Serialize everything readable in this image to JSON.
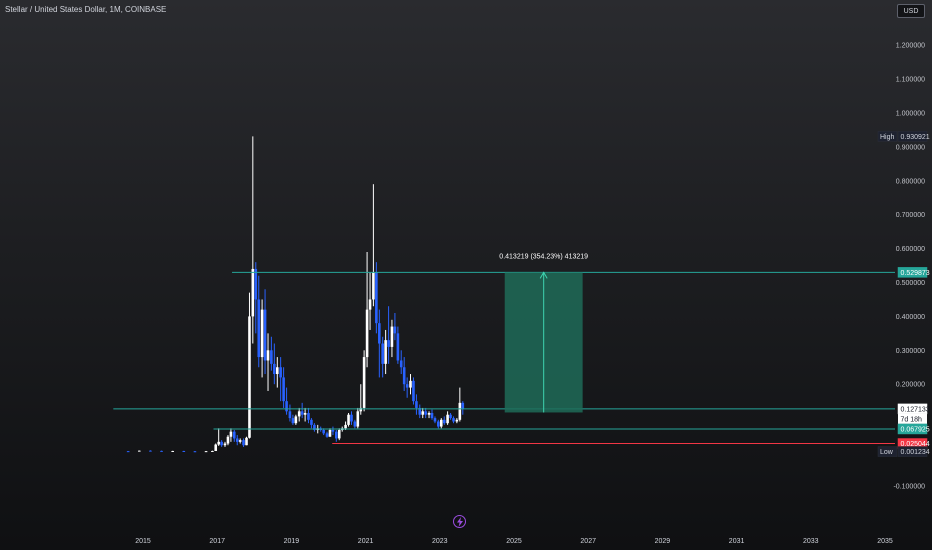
{
  "header": {
    "title": "Stellar / United States Dollar, 1M, COINBASE",
    "currency": "USD"
  },
  "icons": {
    "bolt": "lightning-bolt-icon"
  },
  "chart_data": {
    "type": "candlestick",
    "title": "Stellar / United States Dollar, 1M, COINBASE",
    "ylim": [
      -0.12,
      1.26
    ],
    "xlim": [
      2014.2,
      2035.5
    ],
    "y_ticks": [
      "1.200000",
      "1.100000",
      "1.000000",
      "0.900000",
      "0.800000",
      "0.700000",
      "0.600000",
      "0.500000",
      "0.400000",
      "0.300000",
      "0.200000",
      "-0.100000"
    ],
    "x_ticks": [
      "2015",
      "2017",
      "2019",
      "2021",
      "2023",
      "2025",
      "2027",
      "2029",
      "2031",
      "2033",
      "2035"
    ],
    "colors": {
      "up": "#ffffff",
      "down": "#2962ff",
      "teal": "#26a69a",
      "red": "#f23645",
      "measure": "#1f6b58"
    },
    "horizontal_lines": [
      {
        "value": 0.529873,
        "color": "#26a69a",
        "from": 2017.4,
        "to": 2035.5
      },
      {
        "value": 0.127133,
        "color": "#26a69a",
        "from": 2014.2,
        "to": 2035.5
      },
      {
        "value": 0.067925,
        "color": "#26a69a",
        "from": 2016.9,
        "to": 2035.5
      },
      {
        "value": 0.025044,
        "color": "#f23645",
        "from": 2020.1,
        "to": 2035.5
      }
    ],
    "price_tags": [
      {
        "label": "High",
        "value_text": "0.930921",
        "value": 0.930921,
        "style": "dark"
      },
      {
        "label": "",
        "value_text": "0.529873",
        "value": 0.529873,
        "style": "teal"
      },
      {
        "label": "",
        "value_text": "0.127133",
        "value": 0.127133,
        "style": "white",
        "sub": "7d 18h"
      },
      {
        "label": "",
        "value_text": "0.067925",
        "value": 0.067925,
        "style": "teal"
      },
      {
        "label": "",
        "value_text": "0.025044",
        "value": 0.025044,
        "style": "red"
      },
      {
        "label": "Low",
        "value_text": "0.001234",
        "value": 0.001234,
        "style": "dark"
      }
    ],
    "measure": {
      "label": "0.413219 (354.23%) 413219",
      "x_start": 2024.75,
      "x_end": 2026.85,
      "y_low": 0.116654,
      "y_high": 0.529873
    },
    "candles": [
      [
        2014.6,
        0.0025,
        0.003,
        0.002,
        0.0024
      ],
      [
        2014.9,
        0.0024,
        0.0045,
        0.0018,
        0.004
      ],
      [
        2015.2,
        0.004,
        0.005,
        0.003,
        0.0033
      ],
      [
        2015.5,
        0.0033,
        0.004,
        0.002,
        0.0025
      ],
      [
        2015.8,
        0.0025,
        0.0035,
        0.002,
        0.003
      ],
      [
        2016.1,
        0.003,
        0.0035,
        0.002,
        0.0022
      ],
      [
        2016.4,
        0.0022,
        0.003,
        0.0015,
        0.002
      ],
      [
        2016.7,
        0.002,
        0.003,
        0.0015,
        0.0025
      ],
      [
        2016.87,
        0.0025,
        0.004,
        0.002,
        0.003
      ],
      [
        2016.96,
        0.003,
        0.025,
        0.003,
        0.022
      ],
      [
        2017.04,
        0.022,
        0.07,
        0.018,
        0.03
      ],
      [
        2017.12,
        0.03,
        0.035,
        0.015,
        0.02
      ],
      [
        2017.21,
        0.02,
        0.03,
        0.015,
        0.025
      ],
      [
        2017.29,
        0.025,
        0.05,
        0.02,
        0.045
      ],
      [
        2017.37,
        0.045,
        0.07,
        0.03,
        0.06
      ],
      [
        2017.46,
        0.06,
        0.065,
        0.03,
        0.04
      ],
      [
        2017.54,
        0.04,
        0.05,
        0.02,
        0.03
      ],
      [
        2017.62,
        0.03,
        0.04,
        0.025,
        0.035
      ],
      [
        2017.71,
        0.035,
        0.04,
        0.015,
        0.02
      ],
      [
        2017.79,
        0.02,
        0.045,
        0.02,
        0.042
      ],
      [
        2017.87,
        0.042,
        0.47,
        0.04,
        0.4
      ],
      [
        2017.96,
        0.4,
        0.9309,
        0.32,
        0.54
      ],
      [
        2018.04,
        0.54,
        0.56,
        0.35,
        0.45
      ],
      [
        2018.12,
        0.45,
        0.52,
        0.25,
        0.28
      ],
      [
        2018.21,
        0.28,
        0.45,
        0.22,
        0.42
      ],
      [
        2018.29,
        0.42,
        0.48,
        0.23,
        0.27
      ],
      [
        2018.37,
        0.27,
        0.35,
        0.18,
        0.3
      ],
      [
        2018.46,
        0.3,
        0.34,
        0.24,
        0.26
      ],
      [
        2018.54,
        0.26,
        0.32,
        0.2,
        0.23
      ],
      [
        2018.62,
        0.23,
        0.28,
        0.19,
        0.25
      ],
      [
        2018.71,
        0.25,
        0.28,
        0.15,
        0.22
      ],
      [
        2018.79,
        0.22,
        0.25,
        0.13,
        0.15
      ],
      [
        2018.87,
        0.15,
        0.19,
        0.11,
        0.12
      ],
      [
        2018.96,
        0.12,
        0.14,
        0.09,
        0.1
      ],
      [
        2019.04,
        0.1,
        0.11,
        0.08,
        0.085
      ],
      [
        2019.12,
        0.085,
        0.11,
        0.08,
        0.105
      ],
      [
        2019.21,
        0.105,
        0.13,
        0.09,
        0.12
      ],
      [
        2019.29,
        0.12,
        0.145,
        0.1,
        0.11
      ],
      [
        2019.37,
        0.11,
        0.13,
        0.09,
        0.115
      ],
      [
        2019.46,
        0.115,
        0.13,
        0.085,
        0.095
      ],
      [
        2019.54,
        0.095,
        0.1,
        0.07,
        0.08
      ],
      [
        2019.62,
        0.08,
        0.085,
        0.06,
        0.065
      ],
      [
        2019.71,
        0.065,
        0.08,
        0.055,
        0.07
      ],
      [
        2019.79,
        0.07,
        0.075,
        0.06,
        0.065
      ],
      [
        2019.87,
        0.065,
        0.07,
        0.05,
        0.055
      ],
      [
        2019.96,
        0.055,
        0.06,
        0.042,
        0.045
      ],
      [
        2020.04,
        0.045,
        0.07,
        0.045,
        0.065
      ],
      [
        2020.12,
        0.065,
        0.075,
        0.05,
        0.06
      ],
      [
        2020.21,
        0.06,
        0.065,
        0.03,
        0.04
      ],
      [
        2020.29,
        0.04,
        0.07,
        0.035,
        0.065
      ],
      [
        2020.37,
        0.065,
        0.075,
        0.06,
        0.07
      ],
      [
        2020.46,
        0.07,
        0.09,
        0.065,
        0.08
      ],
      [
        2020.54,
        0.08,
        0.115,
        0.075,
        0.11
      ],
      [
        2020.62,
        0.11,
        0.12,
        0.08,
        0.09
      ],
      [
        2020.71,
        0.09,
        0.095,
        0.07,
        0.075
      ],
      [
        2020.79,
        0.075,
        0.13,
        0.07,
        0.12
      ],
      [
        2020.87,
        0.12,
        0.2,
        0.11,
        0.13
      ],
      [
        2020.96,
        0.13,
        0.3,
        0.12,
        0.28
      ],
      [
        2021.04,
        0.28,
        0.59,
        0.25,
        0.42
      ],
      [
        2021.12,
        0.42,
        0.53,
        0.36,
        0.45
      ],
      [
        2021.21,
        0.45,
        0.79,
        0.43,
        0.53
      ],
      [
        2021.29,
        0.53,
        0.56,
        0.35,
        0.38
      ],
      [
        2021.37,
        0.38,
        0.42,
        0.22,
        0.32
      ],
      [
        2021.46,
        0.32,
        0.34,
        0.22,
        0.26
      ],
      [
        2021.54,
        0.26,
        0.36,
        0.23,
        0.33
      ],
      [
        2021.62,
        0.33,
        0.43,
        0.26,
        0.31
      ],
      [
        2021.71,
        0.31,
        0.39,
        0.28,
        0.37
      ],
      [
        2021.79,
        0.37,
        0.41,
        0.33,
        0.35
      ],
      [
        2021.87,
        0.35,
        0.37,
        0.26,
        0.27
      ],
      [
        2021.96,
        0.27,
        0.3,
        0.23,
        0.25
      ],
      [
        2022.04,
        0.25,
        0.28,
        0.18,
        0.2
      ],
      [
        2022.12,
        0.2,
        0.22,
        0.16,
        0.19
      ],
      [
        2022.21,
        0.19,
        0.23,
        0.17,
        0.21
      ],
      [
        2022.29,
        0.21,
        0.22,
        0.14,
        0.15
      ],
      [
        2022.37,
        0.15,
        0.17,
        0.11,
        0.13
      ],
      [
        2022.46,
        0.13,
        0.14,
        0.1,
        0.11
      ],
      [
        2022.54,
        0.11,
        0.13,
        0.1,
        0.12
      ],
      [
        2022.62,
        0.12,
        0.13,
        0.1,
        0.11
      ],
      [
        2022.71,
        0.11,
        0.12,
        0.1,
        0.115
      ],
      [
        2022.79,
        0.115,
        0.125,
        0.095,
        0.1
      ],
      [
        2022.87,
        0.1,
        0.105,
        0.085,
        0.09
      ],
      [
        2022.96,
        0.09,
        0.095,
        0.07,
        0.075
      ],
      [
        2023.04,
        0.075,
        0.1,
        0.07,
        0.095
      ],
      [
        2023.12,
        0.095,
        0.105,
        0.08,
        0.085
      ],
      [
        2023.21,
        0.085,
        0.12,
        0.08,
        0.11
      ],
      [
        2023.29,
        0.11,
        0.115,
        0.095,
        0.1
      ],
      [
        2023.37,
        0.1,
        0.105,
        0.085,
        0.09
      ],
      [
        2023.46,
        0.09,
        0.1,
        0.085,
        0.095
      ],
      [
        2023.54,
        0.095,
        0.19,
        0.09,
        0.145
      ],
      [
        2023.62,
        0.145,
        0.15,
        0.11,
        0.1271
      ]
    ]
  }
}
